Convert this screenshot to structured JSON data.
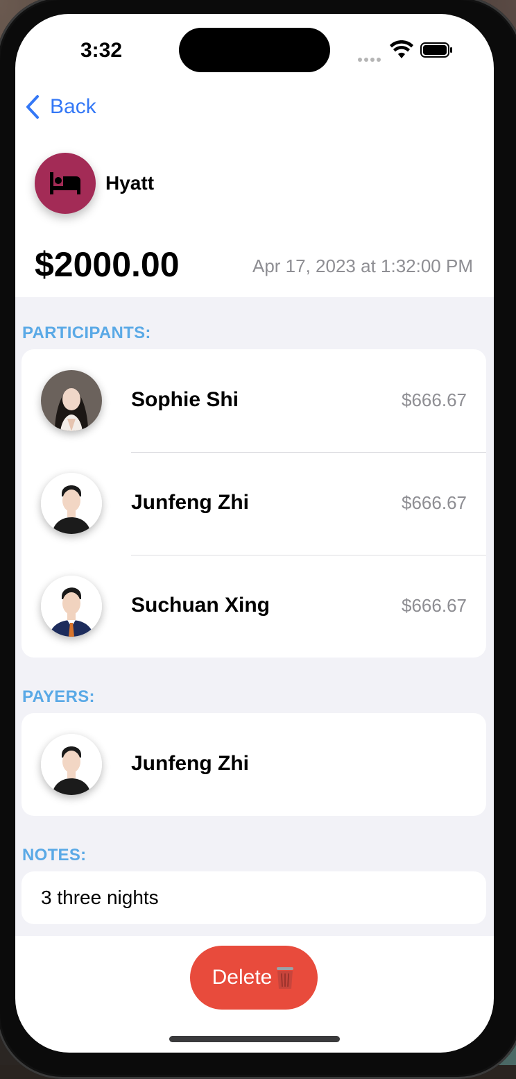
{
  "status_bar": {
    "time": "3:32"
  },
  "nav": {
    "back_label": "Back"
  },
  "expense": {
    "merchant": "Hyatt",
    "category_icon": "bed-icon",
    "category_color": "#a32b56",
    "amount": "$2000.00",
    "date": "Apr 17, 2023 at 1:32:00 PM"
  },
  "participants": {
    "title": "PARTICIPANTS:",
    "items": [
      {
        "name": "Sophie Shi",
        "amount": "$666.67"
      },
      {
        "name": "Junfeng Zhi",
        "amount": "$666.67"
      },
      {
        "name": "Suchuan Xing",
        "amount": "$666.67"
      }
    ]
  },
  "payers": {
    "title": "PAYERS:",
    "items": [
      {
        "name": "Junfeng Zhi"
      }
    ]
  },
  "notes": {
    "title": "NOTES:",
    "text": "3 three nights"
  },
  "actions": {
    "delete_label": "Delete",
    "delete_color": "#e84b3c"
  },
  "colors": {
    "accent": "#3478f6",
    "section_title": "#5aa9e6"
  }
}
